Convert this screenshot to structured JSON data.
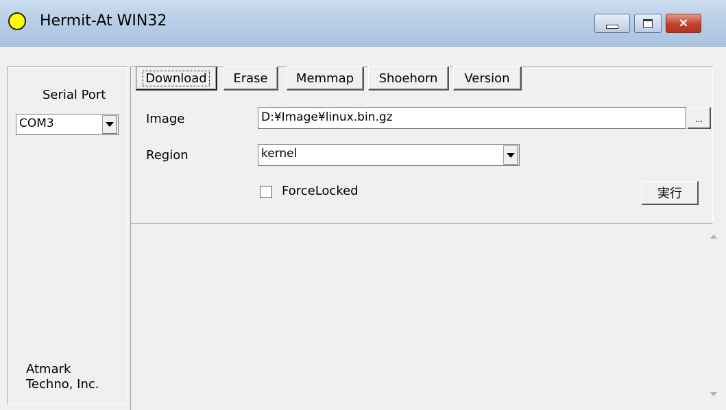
{
  "window": {
    "title": "Hermit-At WIN32",
    "icon": "yellow-circle-icon",
    "controls": {
      "minimize": "minimize-icon",
      "maximize": "maximize-icon",
      "close": "×"
    }
  },
  "left_panel": {
    "serial_port_label": "Serial Port",
    "serial_port_value": "COM3",
    "company_line1": "Atmark",
    "company_line2": "Techno, Inc."
  },
  "tabs": [
    {
      "label": "Download"
    },
    {
      "label": "Erase"
    },
    {
      "label": "Memmap"
    },
    {
      "label": "Shoehorn"
    },
    {
      "label": "Version"
    }
  ],
  "download": {
    "image_label": "Image",
    "image_value": "D:¥Image¥linux.bin.gz",
    "browse_label": "...",
    "region_label": "Region",
    "region_value": "kernel",
    "force_locked_label": "ForceLocked",
    "force_locked_checked": false,
    "run_label": "実行"
  },
  "colors": {
    "window_bg": "#f0f0f0",
    "title_bar": "#b9cfe7",
    "close_button": "#c2402d",
    "app_icon": "#ffff00"
  }
}
